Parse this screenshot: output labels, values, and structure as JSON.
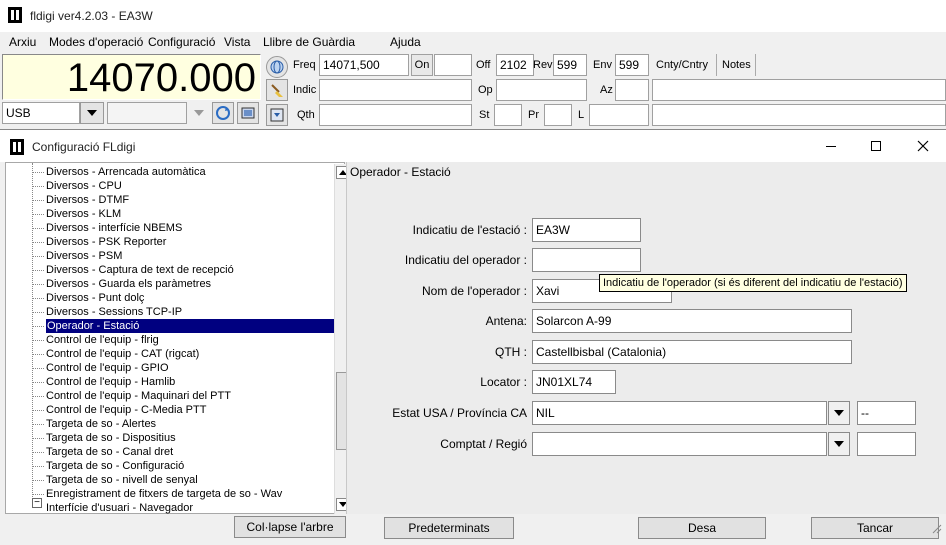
{
  "window": {
    "title": "fldigi ver4.2.03 - EA3W"
  },
  "menu": [
    "Arxiu",
    "Modes d'operació",
    "Configuració",
    "Vista",
    "Llibre de Guàrdia",
    "Ajuda"
  ],
  "main": {
    "frequency": "14070.000",
    "mode": "USB",
    "freq_label": "Freq",
    "freq_value": "14071,500",
    "on_label": "On",
    "off_label": "Off",
    "off_value": "2102",
    "rev_label": "Rev",
    "rev_value": "599",
    "env_label": "Env",
    "env_value": "599",
    "cnty_label": "Cnty/Cntry",
    "notes_label": "Notes",
    "indic_label": "Indic",
    "op_label": "Op",
    "az_label": "Az",
    "qth_label": "Qth",
    "st_label": "St",
    "pr_label": "Pr",
    "l_label": "L"
  },
  "dialog": {
    "title": "Configuració FLdigi",
    "tree_items": [
      "Diversos - Arrencada automàtica",
      "Diversos - CPU",
      "Diversos - DTMF",
      "Diversos - KLM",
      "Diversos - interfície NBEMS",
      "Diversos - PSK Reporter",
      "Diversos - PSM",
      "Diversos - Captura de text de recepció",
      "Diversos - Guarda els paràmetres",
      "Diversos - Punt dolç",
      "Diversos - Sessions TCP-IP",
      "Operador - Estació",
      "Control de l'equip - flrig",
      "Control de l'equip - CAT (rigcat)",
      "Control de l'equip - GPIO",
      "Control de l'equip - Hamlib",
      "Control de l'equip - Maquinari del PTT",
      "Control de l'equip - C-Media PTT",
      "Targeta de so - Alertes",
      "Targeta de so - Dispositius",
      "Targeta de so - Canal dret",
      "Targeta de so - Configuració",
      "Targeta de so - nivell de senyal",
      "Enregistrament de fitxers de targeta de so - Wav",
      "Interfície d'usuari - Navegador"
    ],
    "selected_item": "Operador - Estació",
    "panel_title": "Operador - Estació",
    "fields": {
      "station_callsign_label": "Indicatiu de l'estació :",
      "station_callsign_value": "EA3W",
      "operator_callsign_label": "Indicatiu del operador :",
      "operator_callsign_value": "",
      "operator_name_label": "Nom de l'operador :",
      "operator_name_value": "Xavi",
      "antenna_label": "Antena:",
      "antenna_value": "Solarcon A-99",
      "qth_label": "QTH :",
      "qth_value": "Castellbisbal (Catalonia)",
      "locator_label": "Locator :",
      "locator_value": "JN01XL74",
      "state_label": "Estat USA / Província CA",
      "state_value": "NIL",
      "state_code": "--",
      "county_label": "Comptat / Regió",
      "county_value": ""
    },
    "tooltip": "Indicatiu de l'operador (si és diferent del indicatiu de l'estació)",
    "buttons": {
      "collapse": "Col·lapse l'arbre",
      "defaults": "Predeterminats",
      "save": "Desa",
      "close": "Tancar"
    }
  }
}
